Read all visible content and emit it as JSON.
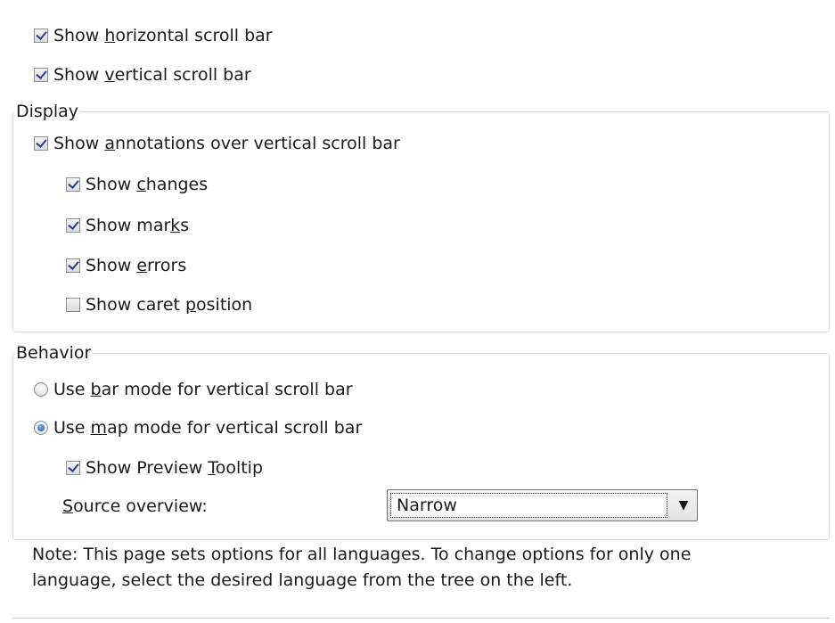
{
  "top_options": [
    {
      "pre": "Show ",
      "mn": "h",
      "post": "orizontal scroll bar",
      "checked": true
    },
    {
      "pre": "Show ",
      "mn": "v",
      "post": "ertical scroll bar",
      "checked": true
    }
  ],
  "display": {
    "legend": "Display",
    "annotations": {
      "pre": "Show ",
      "mn": "a",
      "post": "nnotations over vertical scroll bar",
      "checked": true
    },
    "sub_options": [
      {
        "pre": "Show ",
        "mn": "c",
        "post": "hanges",
        "checked": true
      },
      {
        "pre": "Show mar",
        "mn": "k",
        "post": "s",
        "checked": true
      },
      {
        "pre": "Show ",
        "mn": "e",
        "post": "rrors",
        "checked": true
      },
      {
        "pre": "Show caret ",
        "mn": "p",
        "post": "osition",
        "checked": false
      }
    ]
  },
  "behavior": {
    "legend": "Behavior",
    "bar_mode": {
      "pre": "Use ",
      "mn": "b",
      "post": "ar mode for vertical scroll bar",
      "selected": false
    },
    "map_mode": {
      "pre": "Use ",
      "mn": "m",
      "post": "ap mode for vertical scroll bar",
      "selected": true
    },
    "preview_tooltip": {
      "pre": "Show Preview ",
      "mn": "T",
      "post": "ooltip",
      "checked": true
    },
    "source_overview": {
      "mn": "S",
      "post": "ource overview:",
      "value": "Narrow"
    }
  },
  "note": {
    "line1": "Note: This page sets options for all languages. To change options for only one",
    "line2": "language, select the desired language from the tree on the left."
  }
}
